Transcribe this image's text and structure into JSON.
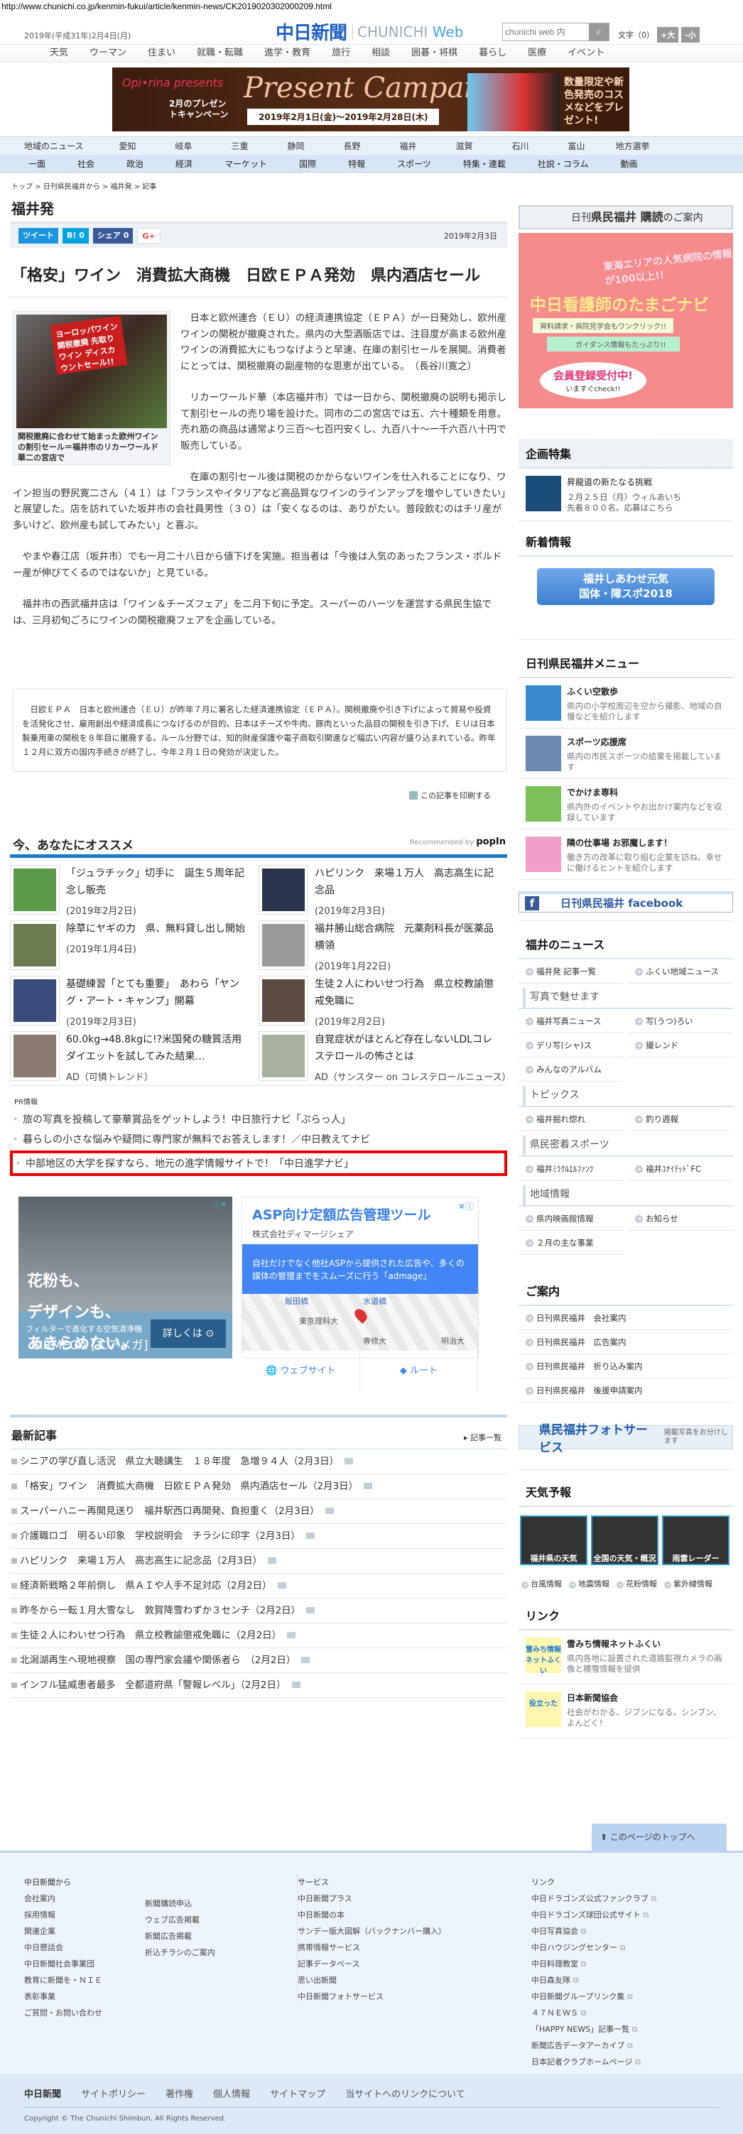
{
  "url": "http://www.chunichi.co.jp/kenmin-fukui/article/kenmin-news/CK2019020302000209.html",
  "header": {
    "date": "2019年(平成31年)2月4日(月)",
    "logo_jp": "中日新聞",
    "logo_en1": "CHUNICHI",
    "logo_en2": "Web",
    "search_placeholder": "chunichi web 内",
    "search_icon": "magnifier-icon",
    "font_label": "文字（0）",
    "font_up": "+大",
    "font_down": "-小"
  },
  "nav_top": [
    "天気",
    "ウーマン",
    "住まい",
    "就職・転職",
    "進学・教育",
    "旅行",
    "相談",
    "囲碁・将棋",
    "暮らし",
    "医療",
    "イベント"
  ],
  "banner": {
    "brand": "Opi•rina presents",
    "sub": "2月のプレゼントキャンペーン",
    "title": "Present Campaign",
    "period": "2019年2月1日(金)～2019年2月28日(木)",
    "side": "数量限定や新色発売のコスメなどをプレゼント!"
  },
  "nav_region": {
    "label": "地域のニュース",
    "items": [
      "愛知",
      "岐阜",
      "三重",
      "静岡",
      "長野",
      "福井",
      "滋賀",
      "石川",
      "富山",
      "地方選挙"
    ]
  },
  "nav_main": [
    "一面",
    "社会",
    "政治",
    "経済",
    "マーケット",
    "国際",
    "特報",
    "スポーツ",
    "特集・連載",
    "社説・コラム",
    "動画"
  ],
  "breadcrumb": "トップ > 日刊県民福井から > 福井発 > 記事",
  "section_title": "福井発",
  "share": {
    "tweet": "ツイート",
    "hatena": "B! 0",
    "facebook": "シェア 0",
    "gplus": "G+",
    "date": "2019年2月3日"
  },
  "article": {
    "headline": "「格安」ワイン　消費拡大商機　日欧ＥＰＡ発効　県内酒店セール",
    "photo_sign": "ヨーロッパワイン 関税撤廃 先取り ワイン ディスカウントセール!!",
    "caption": "関税撤廃に合わせて始まった欧州ワインの割引セール＝福井市のリカーワールド華二の宮店で",
    "paragraphs": [
      "日本と欧州連合（ＥＵ）の経済連携協定（ＥＰＡ）が一日発効し、欧州産ワインの関税が撤廃された。県内の大型酒販店では、注目度が高まる欧州産ワインの消費拡大にもつなげようと早速、在庫の割引セールを展開。消費者にとっては、関税撤廃の副産物的な恩恵が出ている。　（長谷川寛之）",
      "リカーワールド華（本店福井市）では一日から、関税撤廃の説明も掲示して割引セールの売り場を設けた。同市の二の宮店では五、六十種類を用意。売れ筋の商品は通常より三百～七百円安くし、九百八十～一千六百八十円で販売している。",
      "在庫の割引セール後は関税のかからないワインを仕入れることになり、ワイン担当の野尻寛二さん（４１）は「フランスやイタリアなど高品質なワインのラインアップを増やしていきたい」と展望した。店を訪れていた坂井市の会社員男性（３０）は「安くなるのは、ありがたい。普段飲むのはチリ産が多いけど、欧州産も試してみたい」と喜ぶ。",
      "やまや春江店（坂井市）でも一月二十八日から値下げを実施。担当者は「今後は人気のあったフランス・ボルドー産が伸びてくるのではないか」と見ている。",
      "福井市の西武福井店は「ワイン＆チーズフェア」を二月下旬に予定。スーパーのハーツを運営する県民生協では、三月初旬ごろにワインの関税撤廃フェアを企画している。"
    ],
    "note": "日欧ＥＰＡ　日本と欧州連合（ＥＵ）が昨年７月に署名した経済連携協定（ＥＰＡ）。関税撤廃や引き下げによって貿易や投資を活発化させ、雇用創出や経済成長につなげるのが目的。日本はチーズや牛肉、豚肉といった品目の関税を引き下げ、ＥＵは日本製乗用車の関税を８年目に撤廃する。ルール分野では、知的財産保護や電子商取引関連など幅広い内容が盛り込まれている。昨年１２月に双方の国内手続きが終了し、今年２月１日の発効が決定した。",
    "print": "この記事を印刷する"
  },
  "recommend": {
    "title": "今、あなたにオススメ",
    "by": "Recommended by",
    "brand": "popIn",
    "items": [
      {
        "title": "「ジュラチック」切手に　誕生５周年記念し販売",
        "date": "(2019年2月2日)",
        "color": "#5a9a48"
      },
      {
        "title": "ハピリンク　来場１万人　高志高生に記念品",
        "date": "(2019年2月3日)",
        "color": "#2b3550"
      },
      {
        "title": "除草にヤギの力　県、無料貸し出し開始",
        "date": "(2019年1月4日)",
        "color": "#6c7c50"
      },
      {
        "title": "福井勝山総合病院　元薬剤科長が医薬品横領",
        "date": "(2019年1月22日)",
        "color": "#9a9a9a"
      },
      {
        "title": "基礎練習「とても重要」　あわら「ヤング・アート・キャンプ」開幕",
        "date": "(2019年2月3日)",
        "color": "#3a4a7a"
      },
      {
        "title": "生徒２人にわいせつ行為　県立校教諭懲戒免職に",
        "date": "(2019年2月2日)",
        "color": "#5a4a40"
      },
      {
        "title": "60.0kg→48.8kgに!?米国発の糖質活用ダイエットを試してみた結果…",
        "date": "AD（可憐トレンド）",
        "color": "#8a7a70"
      },
      {
        "title": "自覚症状がほとんど存在しないLDLコレステロールの怖さとは",
        "date": "AD（サンスター on コレステロールニュース）",
        "color": "#a8b0a0"
      }
    ]
  },
  "pr": {
    "label": "PR情報",
    "items": [
      "旅の写真を投稿して豪華賞品をゲットしよう！中日旅行ナビ「ぷらっ人」",
      "暮らしの小さな悩みや疑問に専門家が無料でお答えします！／中日教えてナビ",
      "中部地区の大学を探すなら、地元の進学情報サイトで！「中日進学ナビ」"
    ]
  },
  "ad_left": {
    "headline1": "花粉も、",
    "headline2": "デザインも、",
    "headline3": "あきらめない。",
    "sub": "フィルターで進化する空気清浄機",
    "brand": "AIRMEGA [エアメガ]",
    "button": "詳しくは ⊙",
    "choices": "ⓘ✕"
  },
  "ad_right": {
    "title": "ASP向け定額広告管理ツール",
    "company": "株式会社ディマージシェア",
    "desc": "自社だけでなく他社ASPから提供された広告や、多くの媒体の管理までをスムーズに行う「admage」",
    "map_labels": [
      "飯田橋",
      "水道橋",
      "東京理科大",
      "専修大",
      "明治大"
    ],
    "website": "ウェブサイト",
    "route": "ルート",
    "close": "✕ⓘ"
  },
  "latest": {
    "title": "最新記事",
    "more": "▸ 記事一覧",
    "items": [
      "シニアの学び直し活況　県立大聴講生　１８年度　急増９４人（2月3日）",
      "「格安」ワイン　消費拡大商機　日欧ＥＰＡ発効　県内酒店セール（2月3日）",
      "スーパーハニー再開見送り　福井駅西口再開発、負担重く（2月3日）",
      "介護職ロゴ　明るい印象　学校説明会　チラシに印字（2月3日）",
      "ハピリンク　来場１万人　高志高生に記念品（2月3日）",
      "経済新戦略２年前倒し　県ＡＩや人手不足対応（2月2日）",
      "昨冬から一転１月大雪なし　敦賀降雪わずか３センチ（2月2日）",
      "生徒２人にわいせつ行為　県立校教諭懲戒免職に（2月2日）",
      "北潟湖再生へ現地視察　国の専門家会議や関係者ら　（2月2日）",
      "インフル猛威患者最多　全都道府県「警報レベル」（2月2日）"
    ]
  },
  "sidebar": {
    "subscribe": {
      "small": "日刊",
      "big": "県民福井 購読",
      "tail": "のご案内"
    },
    "nurse_ad": {
      "top": "東海エリアの人気病院の情報が100以上!!",
      "title": "中日看護師のたまごナビ",
      "l1": "資料請求・病院見学会もワンクリック!!",
      "l2": "ガイダンス情報もたっぷり!!",
      "cta": "会員登録受付中!",
      "check": "いますぐcheck!!"
    },
    "kikaku": {
      "title": "企画特集",
      "item_title": "昇龍道の新たなる挑戦",
      "item_desc1": "２月２５日（月）ウィルあいち",
      "item_desc2": "先着８００名。応募はこちら"
    },
    "shinchaku": {
      "title": "新着情報",
      "banner1": "福井しあわせ元気",
      "banner2": "国体・障スポ2018"
    },
    "menu": {
      "title": "日刊県民福井メニュー",
      "items": [
        {
          "title": "ふくい空散歩",
          "desc": "県内の小学校周辺を空から撮影、地域の自慢などを紹介します",
          "color": "#3a8ad0"
        },
        {
          "title": "スポーツ応援席",
          "desc": "県内の市民スポーツの結果を掲載しています",
          "color": "#6a88b0"
        },
        {
          "title": "でかけま専科",
          "desc": "県内外のイベントやお出かけ案内などを収録しています",
          "color": "#7cc05a"
        },
        {
          "title": "隣の仕事場 お邪魔します！",
          "desc": "働き方の改革に取り組む企業を訪ね、幸せに働けるヒントを紹介します",
          "color": "#f0a0c8"
        }
      ]
    },
    "facebook": "日刊県民福井 facebook",
    "fukui_news": {
      "title": "福井のニュース",
      "top": [
        "福井発 記事一覧",
        "ふくい地域ニュース"
      ],
      "photo_title": "写真で魅せます",
      "photo": [
        "福井写真ニュース",
        "写(うつ)ろい",
        "デリ写(シャ)ス",
        "撮レンド",
        "みんなのアルバム"
      ],
      "topics_title": "トピックス",
      "topics": [
        "福井掘れ惚れ",
        "釣り週報"
      ],
      "sports_title": "県民密着スポーツ",
      "sports": [
        "福井ﾐﾗｸﾙｴﾙﾌｧﾝﾂ",
        "福井ﾕﾅｲﾃｯﾄﾞFC"
      ],
      "region_title": "地域情報",
      "region": [
        "県内映画館情報",
        "お知らせ",
        "２月の主な事業"
      ]
    },
    "guide": {
      "title": "ご案内",
      "items": [
        "日刊県民福井　会社案内",
        "日刊県民福井　広告案内",
        "日刊県民福井　折り込み案内",
        "日刊県民福井　後援申請案内"
      ]
    },
    "photo_service": {
      "title": "県民福井フォトサービス",
      "sub": "掲載写真をお分けします"
    },
    "weather": {
      "title": "天気予報",
      "tiles": [
        "福井県の天気",
        "全国の天気・概況",
        "雨雲レーダー"
      ],
      "links": [
        "台風情報",
        "地震情報",
        "花粉情報",
        "紫外線情報"
      ]
    },
    "links": {
      "title": "リンク",
      "items": [
        {
          "title": "雪みち情報ネットふくい",
          "desc": "県内各地に設置された道路監視カメラの画像と積雪情報を提供",
          "thumb": "雪みち情報ネットふくい"
        },
        {
          "title": "日本新聞協会",
          "desc": "社会がわかる、ジブンになる。シンブン、よんどく！",
          "thumb": "役立った"
        }
      ]
    }
  },
  "footer": {
    "top_button": "このページのトップへ",
    "col1_title": "中日新聞から",
    "col1a": [
      "会社案内",
      "採用情報",
      "関連企業",
      "中日懇話会",
      "中日新聞社会事業団",
      "教育に新聞を・ＮＩＥ",
      "表彰事業",
      "ご質問・お問い合わせ"
    ],
    "col1b": [
      "新聞購読申込",
      "ウェブ広告掲載",
      "新聞広告掲載",
      "折込チラシのご案内"
    ],
    "col2_title": "サービス",
    "col2": [
      "中日新聞プラス",
      "中日新聞の本",
      "サンデー版大図解（バックナンバー購入）",
      "携帯情報サービス",
      "記事データベース",
      "思い出新聞",
      "中日新聞フォトサービス"
    ],
    "col3_title": "リンク",
    "col3": [
      "中日ドラゴンズ公式ファンクラブ",
      "中日ドラゴンズ球団公式サイト",
      "中日写真協会",
      "中日ハウジングセンター",
      "中日料理教室",
      "中日森友隊",
      "中日新聞グループリンク集",
      "４７ＮＥＷＳ",
      "「HAPPY NEWS」記事一覧",
      "新聞広告データアーカイブ",
      "日本記者クラブホームページ"
    ],
    "bottom_logo": "中日新聞",
    "bottom_links": [
      "サイトポリシー",
      "著作権",
      "個人情報",
      "サイトマップ",
      "当サイトへのリンクについて"
    ],
    "copyright": "Copyright © The Chunichi Shimbun, All Rights Reserved."
  },
  "colors": {
    "brand": "#1f5fc4",
    "accent": "#1a7bc4",
    "highlight": "#ee0000"
  }
}
